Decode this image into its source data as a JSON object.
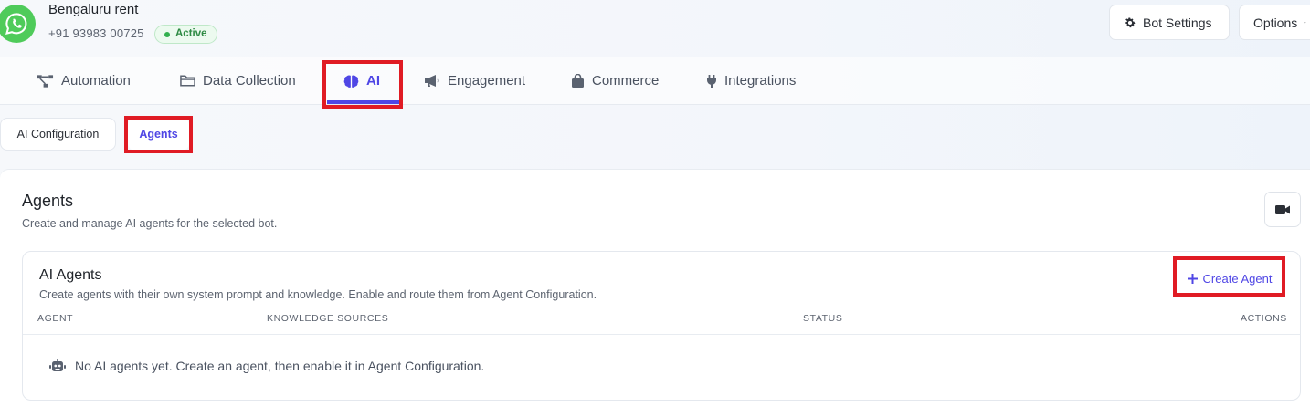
{
  "header": {
    "bot_name": "Bengaluru rent",
    "phone": "+91 93983 00725",
    "status": "Active",
    "bot_settings_label": "Bot Settings",
    "options_label": "Options"
  },
  "tabs": [
    {
      "label": "Automation",
      "icon": "workflow-icon"
    },
    {
      "label": "Data Collection",
      "icon": "folder-icon"
    },
    {
      "label": "AI",
      "icon": "brain-icon",
      "active": true
    },
    {
      "label": "Engagement",
      "icon": "megaphone-icon"
    },
    {
      "label": "Commerce",
      "icon": "shopping-bag-icon"
    },
    {
      "label": "Integrations",
      "icon": "plug-icon"
    }
  ],
  "subtabs": [
    {
      "label": "AI Configuration"
    },
    {
      "label": "Agents",
      "active": true
    }
  ],
  "section": {
    "title": "Agents",
    "subtitle": "Create and manage AI agents for the selected bot."
  },
  "agents_panel": {
    "title": "AI Agents",
    "subtitle": "Create agents with their own system prompt and knowledge. Enable and route them from Agent Configuration.",
    "create_label": "Create Agent",
    "columns": [
      "AGENT",
      "KNOWLEDGE SOURCES",
      "STATUS",
      "ACTIONS"
    ],
    "empty_message": "No AI agents yet. Create an agent, then enable it in Agent Configuration."
  },
  "colors": {
    "accent": "#4f46e5",
    "whatsapp_green": "#4fcb5a",
    "status_green": "#2d8a43",
    "highlight_red": "#e01b24"
  }
}
